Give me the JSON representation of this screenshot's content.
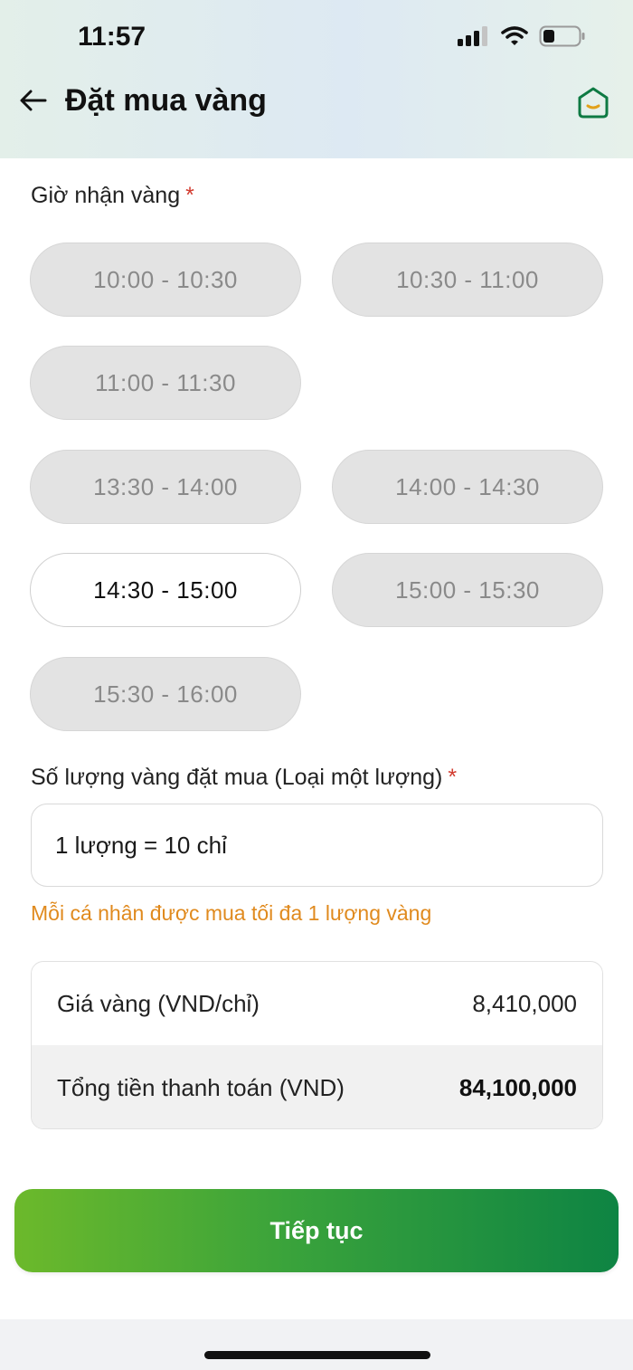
{
  "status_bar": {
    "time": "11:57"
  },
  "header": {
    "title": "Đặt mua vàng",
    "back_icon": "arrow-left-icon",
    "home_icon": "home-smile-icon"
  },
  "pickup": {
    "label": "Giờ nhận vàng",
    "required_mark": "*",
    "slots": [
      {
        "label": "10:00 - 10:30",
        "state": "disabled"
      },
      {
        "label": "10:30 - 11:00",
        "state": "disabled"
      },
      {
        "label": "11:00 - 11:30",
        "state": "disabled"
      },
      {
        "label": "13:30 - 14:00",
        "state": "disabled"
      },
      {
        "label": "14:00 - 14:30",
        "state": "disabled"
      },
      {
        "label": "14:30 - 15:00",
        "state": "available"
      },
      {
        "label": "15:00 - 15:30",
        "state": "disabled"
      },
      {
        "label": "15:30 - 16:00",
        "state": "disabled"
      }
    ]
  },
  "quantity": {
    "label": "Số lượng vàng đặt mua (Loại một lượng)",
    "required_mark": "*",
    "value": "1 lượng = 10 chỉ",
    "hint": "Mỗi cá nhân được mua tối đa 1 lượng vàng"
  },
  "summary": {
    "price_label": "Giá vàng (VND/chỉ)",
    "price_value": "8,410,000",
    "total_label": "Tổng tiền thanh toán (VND)",
    "total_value": "84,100,000"
  },
  "actions": {
    "continue_label": "Tiếp tục"
  },
  "colors": {
    "accent_start": "#6cb92b",
    "accent_end": "#0e8443",
    "hint": "#e08a1e",
    "required": "#d23b2f"
  }
}
